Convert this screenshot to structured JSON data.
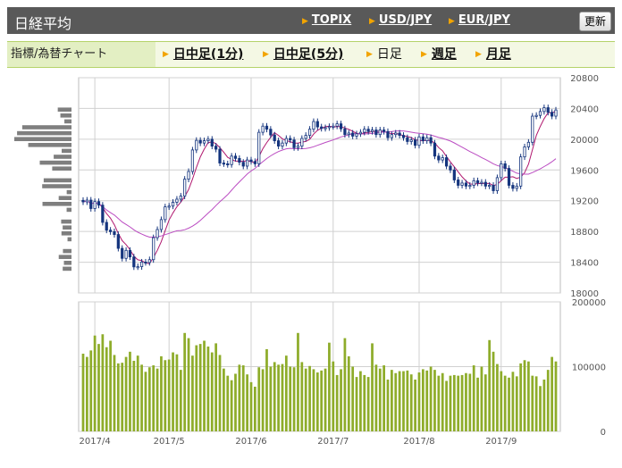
{
  "header": {
    "title": "日経平均",
    "links": [
      {
        "label": "TOPIX"
      },
      {
        "label": "USD/JPY"
      },
      {
        "label": "EUR/JPY"
      }
    ],
    "update_label": "更新"
  },
  "menu": {
    "label": "指標/為替チャート",
    "items": [
      {
        "label": "日中足(1分)",
        "state": "link"
      },
      {
        "label": "日中足(5分)",
        "state": "link"
      },
      {
        "label": "日足",
        "state": "current"
      },
      {
        "label": "週足",
        "state": "link"
      },
      {
        "label": "月足",
        "state": "link"
      }
    ]
  },
  "colors": {
    "candle": "#15357e",
    "ma_short": "#b0186f",
    "ma_long": "#bb4cc2",
    "volume_bar": "#8eac2a",
    "profile_bar": "#7f7f7f",
    "grid": "#d0d0d0"
  },
  "chart_data": [
    {
      "type": "candlestick",
      "title": "",
      "x_labels": [
        "2017/4",
        "2017/5",
        "2017/6",
        "2017/7",
        "2017/8",
        "2017/9"
      ],
      "y_ticks": [
        18000,
        18400,
        18800,
        19200,
        19600,
        20000,
        20400,
        20800
      ],
      "ylim": [
        18000,
        20800
      ],
      "grid": true,
      "close": [
        19185,
        19208,
        19098,
        19189,
        19142,
        18918,
        18817,
        18797,
        18760,
        18580,
        18450,
        18554,
        18469,
        18339,
        18342,
        18402,
        18396,
        18433,
        18719,
        18825,
        18954,
        19120,
        19130,
        19180,
        19220,
        19260,
        19480,
        19580,
        19860,
        19985,
        19950,
        19980,
        20000,
        19910,
        19870,
        19690,
        19680,
        19670,
        19780,
        19750,
        19700,
        19650,
        19730,
        19710,
        19680,
        20090,
        20170,
        20130,
        20055,
        19980,
        19910,
        19950,
        20010,
        19990,
        19890,
        19910,
        20010,
        20050,
        20130,
        20230,
        20160,
        20140,
        20150,
        20165,
        20170,
        20200,
        20135,
        20060,
        20080,
        20040,
        20070,
        20090,
        20130,
        20100,
        20120,
        20060,
        20120,
        20100,
        20020,
        20060,
        20080,
        20050,
        20020,
        19970,
        19990,
        19920,
        20030,
        19980,
        20020,
        19950,
        19780,
        19730,
        19760,
        19650,
        19600,
        19470,
        19400,
        19430,
        19390,
        19400,
        19460,
        19430,
        19440,
        19390,
        19400,
        19330,
        19500,
        19680,
        19620,
        19400,
        19360,
        19390,
        19770,
        19900,
        19960,
        20300,
        20310,
        20360,
        20410,
        20350,
        20300,
        20380
      ]
    },
    {
      "type": "bar",
      "title": "",
      "x_labels": [
        "2017/4",
        "2017/5",
        "2017/6",
        "2017/7",
        "2017/8",
        "2017/9"
      ],
      "y_ticks": [
        0,
        100000,
        200000
      ],
      "ylim": [
        0,
        200000
      ],
      "values": [
        120000,
        115000,
        125000,
        148000,
        135000,
        150000,
        130000,
        140000,
        118000,
        105000,
        106000,
        115000,
        123000,
        109000,
        117000,
        103000,
        92000,
        99000,
        102000,
        97000,
        116000,
        110000,
        111000,
        122000,
        119000,
        95000,
        152000,
        144000,
        117000,
        133000,
        135000,
        140000,
        131000,
        122000,
        136000,
        118000,
        97000,
        86000,
        79000,
        89000,
        103000,
        102000,
        88000,
        76000,
        69000,
        99000,
        96000,
        127000,
        100000,
        107000,
        103000,
        104000,
        117000,
        100000,
        99000,
        152000,
        107000,
        97000,
        101000,
        96000,
        91000,
        94000,
        97000,
        137000,
        108000,
        87000,
        96000,
        144000,
        116000,
        100000,
        84000,
        93000,
        87000,
        84000,
        136000,
        103000,
        97000,
        102000,
        80000,
        95000,
        90000,
        93000,
        93000,
        94000,
        88000,
        80000,
        91000,
        96000,
        94000,
        100000,
        95000,
        86000,
        90000,
        78000,
        86000,
        87000,
        86000,
        87000,
        90000,
        89000,
        102000,
        83000,
        100000,
        88000,
        141000,
        123000,
        104000,
        93000,
        86000,
        83000,
        92000,
        85000,
        105000,
        110000,
        108000,
        86000,
        85000,
        70000,
        80000,
        95000,
        115000,
        108000
      ]
    }
  ]
}
